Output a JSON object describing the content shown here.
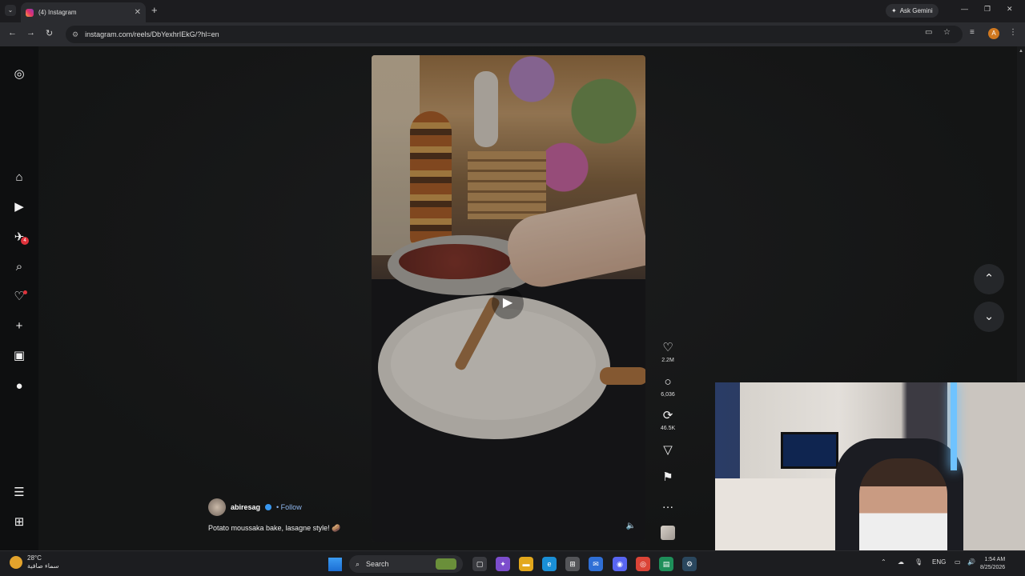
{
  "browser": {
    "tab_title": "(4) Instagram",
    "tab_close": "✕",
    "new_tab": "+",
    "tab_list": "⌄",
    "ask_gemini": "Ask Gemini",
    "url": "instagram.com/reels/DbYexhrIEkG/?hl=en",
    "profile_initial": "A"
  },
  "sidebar": {
    "notifications_badge": "4"
  },
  "reel": {
    "likes": "2.2M",
    "comments": "6,036",
    "reposts": "46.5K",
    "author": "abiresag",
    "follow": "• Follow",
    "caption": "Potato moussaka bake, lasagne style! 🥔"
  },
  "taskbar": {
    "temperature": "28°C",
    "weather_desc": "سماء صافية",
    "search_placeholder": "Search",
    "language": "ENG",
    "time": "1:54 AM",
    "date": "8/25/2026"
  },
  "colors": {
    "accent": "#3897f0",
    "badge": "#e0323b"
  }
}
